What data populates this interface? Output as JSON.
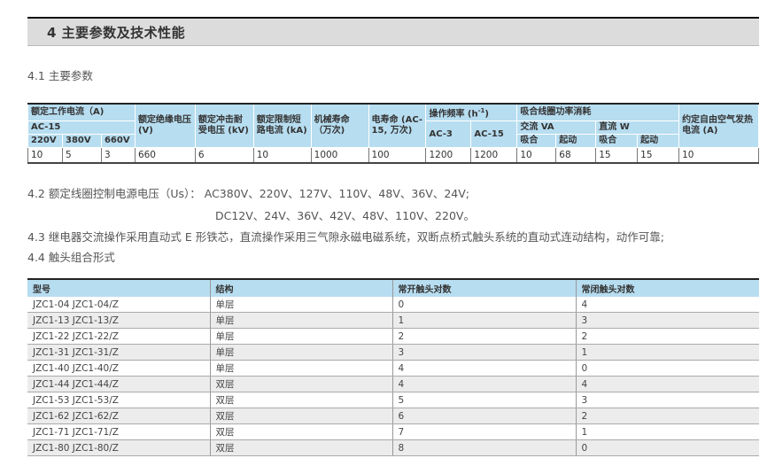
{
  "section": {
    "title": "4 主要参数及技术性能"
  },
  "s41": {
    "title": "4.1 主要参数"
  },
  "params": {
    "h_current": "额定工作电流（A)",
    "h_ac15": "AC-15",
    "h_220": "220V",
    "h_380": "380V",
    "h_660": "660V",
    "h_insul": "额定绝缘电压 (V)",
    "h_impulse": "额定冲击耐受电压 (kV)",
    "h_short": "额定限制短路电流 (kA)",
    "h_mech": "机械寿命（万次)",
    "h_elec": "电寿命 (AC-15, 万次)",
    "h_freq": "操作频率 (h",
    "h_freq_sup": "-1",
    "h_freq_end": ")",
    "h_freq_ac3": "AC-3",
    "h_freq_ac15": "AC-15",
    "h_coil": "吸合线圈功率消耗",
    "h_ac_va": "交流 VA",
    "h_dc_w": "直流 W",
    "h_pull1": "吸合",
    "h_start1": "起动",
    "h_pull2": "吸合",
    "h_start2": "起动",
    "h_thermal": "约定自由空气发热电流 (A)",
    "row": [
      "10",
      "5",
      "3",
      "660",
      "6",
      "10",
      "1000",
      "100",
      "1200",
      "1200",
      "10",
      "68",
      "15",
      "15",
      "10"
    ]
  },
  "s42": {
    "text": "4.2 额定线圈控制电源电压（Us）：  AC380V、220V、127V、110V、48V、36V、24V;",
    "text2": "DC12V、24V、36V、42V、48V、110V、220V。"
  },
  "s43": {
    "text": "4.3 继电器交流操作采用直动式 E 形铁芯，直流操作采用三气隙永磁电磁系统，双断点桥式触头系统的直动式连动结构，动作可靠;"
  },
  "s44": {
    "text": "4.4 触头组合形式"
  },
  "combo": {
    "headers": [
      "型号",
      "结构",
      "常开触头对数",
      "常闭触头对数"
    ],
    "rows": [
      [
        "JZC1-04  JZC1-04/Z",
        "单层",
        "0",
        "4"
      ],
      [
        "JZC1-13  JZC1-13/Z",
        "单层",
        "1",
        "3"
      ],
      [
        "JZC1-22  JZC1-22/Z",
        "单层",
        "2",
        "2"
      ],
      [
        "JZC1-31  JZC1-31/Z",
        "单层",
        "3",
        "1"
      ],
      [
        "JZC1-40  JZC1-40/Z",
        "单层",
        "4",
        "0"
      ],
      [
        "JZC1-44  JZC1-44/Z",
        "双层",
        "4",
        "4"
      ],
      [
        "JZC1-53  JZC1-53/Z",
        "双层",
        "5",
        "3"
      ],
      [
        "JZC1-62  JZC1-62/Z",
        "双层",
        "6",
        "2"
      ],
      [
        "JZC1-71  JZC1-71/Z",
        "双层",
        "7",
        "1"
      ],
      [
        "JZC1-80  JZC1-80/Z",
        "双层",
        "8",
        "0"
      ]
    ]
  }
}
